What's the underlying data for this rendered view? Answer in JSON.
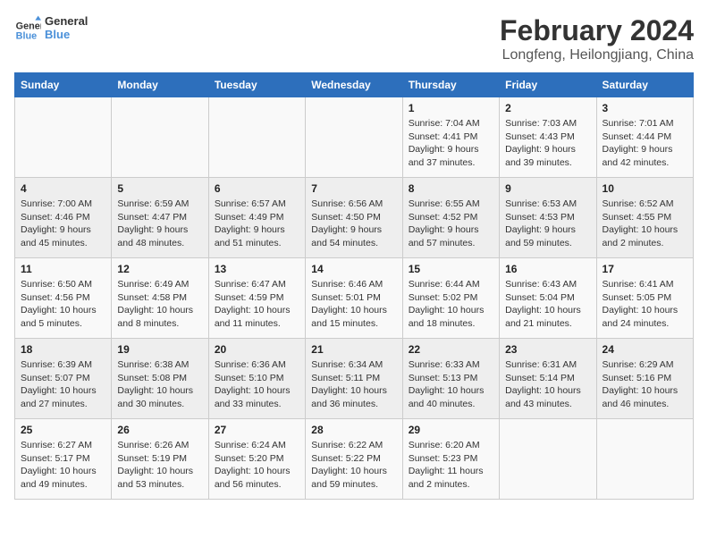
{
  "logo": {
    "text_general": "General",
    "text_blue": "Blue"
  },
  "header": {
    "title": "February 2024",
    "subtitle": "Longfeng, Heilongjiang, China"
  },
  "days_of_week": [
    "Sunday",
    "Monday",
    "Tuesday",
    "Wednesday",
    "Thursday",
    "Friday",
    "Saturday"
  ],
  "weeks": [
    [
      {
        "day": "",
        "info": ""
      },
      {
        "day": "",
        "info": ""
      },
      {
        "day": "",
        "info": ""
      },
      {
        "day": "",
        "info": ""
      },
      {
        "day": "1",
        "info": "Sunrise: 7:04 AM\nSunset: 4:41 PM\nDaylight: 9 hours\nand 37 minutes."
      },
      {
        "day": "2",
        "info": "Sunrise: 7:03 AM\nSunset: 4:43 PM\nDaylight: 9 hours\nand 39 minutes."
      },
      {
        "day": "3",
        "info": "Sunrise: 7:01 AM\nSunset: 4:44 PM\nDaylight: 9 hours\nand 42 minutes."
      }
    ],
    [
      {
        "day": "4",
        "info": "Sunrise: 7:00 AM\nSunset: 4:46 PM\nDaylight: 9 hours\nand 45 minutes."
      },
      {
        "day": "5",
        "info": "Sunrise: 6:59 AM\nSunset: 4:47 PM\nDaylight: 9 hours\nand 48 minutes."
      },
      {
        "day": "6",
        "info": "Sunrise: 6:57 AM\nSunset: 4:49 PM\nDaylight: 9 hours\nand 51 minutes."
      },
      {
        "day": "7",
        "info": "Sunrise: 6:56 AM\nSunset: 4:50 PM\nDaylight: 9 hours\nand 54 minutes."
      },
      {
        "day": "8",
        "info": "Sunrise: 6:55 AM\nSunset: 4:52 PM\nDaylight: 9 hours\nand 57 minutes."
      },
      {
        "day": "9",
        "info": "Sunrise: 6:53 AM\nSunset: 4:53 PM\nDaylight: 9 hours\nand 59 minutes."
      },
      {
        "day": "10",
        "info": "Sunrise: 6:52 AM\nSunset: 4:55 PM\nDaylight: 10 hours\nand 2 minutes."
      }
    ],
    [
      {
        "day": "11",
        "info": "Sunrise: 6:50 AM\nSunset: 4:56 PM\nDaylight: 10 hours\nand 5 minutes."
      },
      {
        "day": "12",
        "info": "Sunrise: 6:49 AM\nSunset: 4:58 PM\nDaylight: 10 hours\nand 8 minutes."
      },
      {
        "day": "13",
        "info": "Sunrise: 6:47 AM\nSunset: 4:59 PM\nDaylight: 10 hours\nand 11 minutes."
      },
      {
        "day": "14",
        "info": "Sunrise: 6:46 AM\nSunset: 5:01 PM\nDaylight: 10 hours\nand 15 minutes."
      },
      {
        "day": "15",
        "info": "Sunrise: 6:44 AM\nSunset: 5:02 PM\nDaylight: 10 hours\nand 18 minutes."
      },
      {
        "day": "16",
        "info": "Sunrise: 6:43 AM\nSunset: 5:04 PM\nDaylight: 10 hours\nand 21 minutes."
      },
      {
        "day": "17",
        "info": "Sunrise: 6:41 AM\nSunset: 5:05 PM\nDaylight: 10 hours\nand 24 minutes."
      }
    ],
    [
      {
        "day": "18",
        "info": "Sunrise: 6:39 AM\nSunset: 5:07 PM\nDaylight: 10 hours\nand 27 minutes."
      },
      {
        "day": "19",
        "info": "Sunrise: 6:38 AM\nSunset: 5:08 PM\nDaylight: 10 hours\nand 30 minutes."
      },
      {
        "day": "20",
        "info": "Sunrise: 6:36 AM\nSunset: 5:10 PM\nDaylight: 10 hours\nand 33 minutes."
      },
      {
        "day": "21",
        "info": "Sunrise: 6:34 AM\nSunset: 5:11 PM\nDaylight: 10 hours\nand 36 minutes."
      },
      {
        "day": "22",
        "info": "Sunrise: 6:33 AM\nSunset: 5:13 PM\nDaylight: 10 hours\nand 40 minutes."
      },
      {
        "day": "23",
        "info": "Sunrise: 6:31 AM\nSunset: 5:14 PM\nDaylight: 10 hours\nand 43 minutes."
      },
      {
        "day": "24",
        "info": "Sunrise: 6:29 AM\nSunset: 5:16 PM\nDaylight: 10 hours\nand 46 minutes."
      }
    ],
    [
      {
        "day": "25",
        "info": "Sunrise: 6:27 AM\nSunset: 5:17 PM\nDaylight: 10 hours\nand 49 minutes."
      },
      {
        "day": "26",
        "info": "Sunrise: 6:26 AM\nSunset: 5:19 PM\nDaylight: 10 hours\nand 53 minutes."
      },
      {
        "day": "27",
        "info": "Sunrise: 6:24 AM\nSunset: 5:20 PM\nDaylight: 10 hours\nand 56 minutes."
      },
      {
        "day": "28",
        "info": "Sunrise: 6:22 AM\nSunset: 5:22 PM\nDaylight: 10 hours\nand 59 minutes."
      },
      {
        "day": "29",
        "info": "Sunrise: 6:20 AM\nSunset: 5:23 PM\nDaylight: 11 hours\nand 2 minutes."
      },
      {
        "day": "",
        "info": ""
      },
      {
        "day": "",
        "info": ""
      }
    ]
  ]
}
